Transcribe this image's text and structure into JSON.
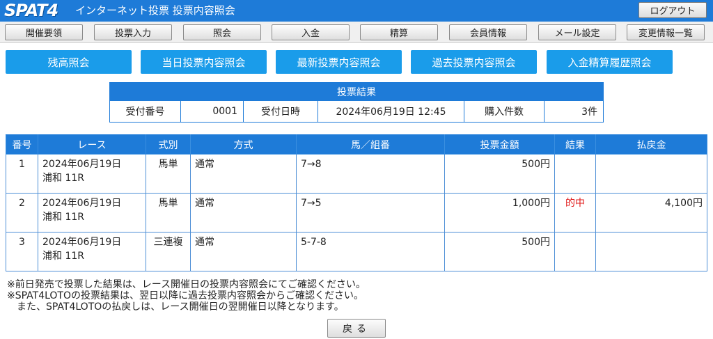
{
  "header": {
    "logo": "SPAT4",
    "title": "インターネット投票 投票内容照会",
    "logout_label": "ログアウト"
  },
  "nav": {
    "items": [
      "開催要領",
      "投票入力",
      "照会",
      "入金",
      "精算",
      "会員情報",
      "メール設定",
      "変更情報一覧"
    ]
  },
  "subnav": {
    "items": [
      "残高照会",
      "当日投票内容照会",
      "最新投票内容照会",
      "過去投票内容照会",
      "入金精算履歴照会"
    ]
  },
  "summary": {
    "title": "投票結果",
    "receipt_no_label": "受付番号",
    "receipt_no": "0001",
    "receipt_datetime_label": "受付日時",
    "receipt_datetime": "2024年06月19日 12:45",
    "purchase_count_label": "購入件数",
    "purchase_count": "3件"
  },
  "results": {
    "headers": [
      "番号",
      "レース",
      "式別",
      "方式",
      "馬／組番",
      "投票金額",
      "結果",
      "払戻金"
    ],
    "rows": [
      {
        "no": "1",
        "race_date": "2024年06月19日",
        "race_venue": "浦和 11R",
        "type": "馬単",
        "method": "通常",
        "combo": "7→8",
        "amount": "500円",
        "result": "",
        "payout": ""
      },
      {
        "no": "2",
        "race_date": "2024年06月19日",
        "race_venue": "浦和 11R",
        "type": "馬単",
        "method": "通常",
        "combo": "7→5",
        "amount": "1,000円",
        "result": "的中",
        "payout": "4,100円"
      },
      {
        "no": "3",
        "race_date": "2024年06月19日",
        "race_venue": "浦和 11R",
        "type": "三連複",
        "method": "通常",
        "combo": "5-7-8",
        "amount": "500円",
        "result": "",
        "payout": ""
      }
    ]
  },
  "notes": {
    "line1": "※前日発売で投票した結果は、レース開催日の投票内容照会にてご確認ください。",
    "line2": "※SPAT4LOTOの投票結果は、翌日以降に過去投票内容照会からご確認ください。",
    "line3": "　また、SPAT4LOTOの払戻しは、レース開催日の翌開催日以降となります。"
  },
  "back_label": "戻る",
  "colors": {
    "header_bg": "#1e7bd8",
    "subnav_bg": "#1a9cea",
    "hit": "#e01919"
  }
}
